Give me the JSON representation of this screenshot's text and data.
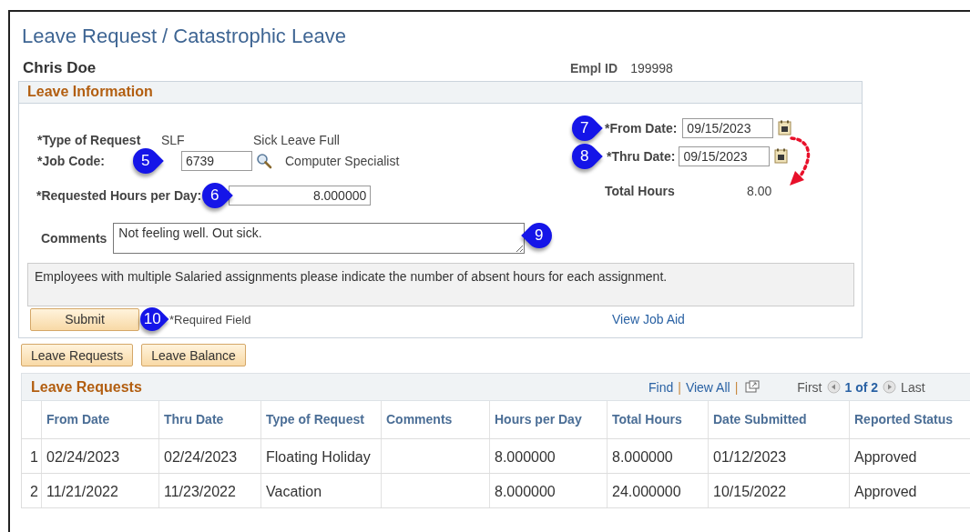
{
  "page_title": "Leave Request / Catastrophic Leave",
  "employee": {
    "name": "Chris Doe",
    "id_label": "Empl ID",
    "id": "199998"
  },
  "leave_information": {
    "title": "Leave Information",
    "type_of_request": {
      "label": "*Type of Request",
      "code": "SLF",
      "description": "Sick Leave Full"
    },
    "job_code": {
      "label": "*Job Code:",
      "value": "6739",
      "description": "Computer Specialist",
      "callout": {
        "number": "5",
        "points_left": false
      }
    },
    "requested_hours": {
      "label": "*Requested Hours per Day:",
      "value": "8.000000",
      "callout": {
        "number": "6",
        "points_left": false
      }
    },
    "from_date": {
      "label": "*From Date:",
      "value": "09/15/2023",
      "callout": {
        "number": "7",
        "points_left": false
      }
    },
    "thru_date": {
      "label": "*Thru Date:",
      "value": "09/15/2023",
      "callout": {
        "number": "8",
        "points_left": false
      }
    },
    "total_hours": {
      "label": "Total Hours",
      "value": "8.00"
    },
    "comments": {
      "label": "Comments",
      "value": "Not feeling well. Out sick.",
      "callout": {
        "number": "9",
        "points_left": true
      }
    },
    "note": "Employees with multiple Salaried assignments please indicate the number of absent hours for each assignment.",
    "submit": {
      "label": "Submit",
      "callout": {
        "number": "10",
        "points_left": false
      }
    },
    "required_note": "*Required Field",
    "job_aid_link": "View Job Aid"
  },
  "buttons": [
    "Leave Requests",
    "Leave Balance"
  ],
  "grid": {
    "title": "Leave Requests",
    "find": "Find",
    "view_all": "View All",
    "separators": [
      "|",
      "|"
    ],
    "first": "First",
    "page": "1 of 2",
    "last": "Last",
    "columns": [
      "From Date",
      "Thru Date",
      "Type of Request",
      "Comments",
      "Hours per Day",
      "Total Hours",
      "Date Submitted",
      "Reported Status"
    ],
    "rows": [
      {
        "number": "1",
        "cells": [
          "02/24/2023",
          "02/24/2023",
          "Floating Holiday",
          "",
          "8.000000",
          "8.000000",
          "01/12/2023",
          "Approved"
        ]
      },
      {
        "number": "2",
        "cells": [
          "11/21/2022",
          "11/23/2022",
          "Vacation",
          "",
          "8.000000",
          "24.000000",
          "10/15/2022",
          "Approved"
        ]
      }
    ]
  }
}
